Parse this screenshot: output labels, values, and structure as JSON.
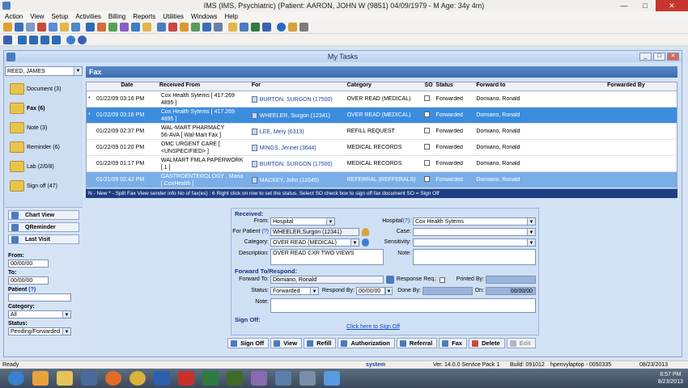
{
  "window": {
    "title": "IMS (IMS, Psychiatric)    (Patient: AARON, JOHN W (9851) 04/09/1979 - M Age: 34y 4m)"
  },
  "menu": [
    "Action",
    "View",
    "Setup",
    "Activities",
    "Billing",
    "Reports",
    "Utilities",
    "Windows",
    "Help"
  ],
  "mdi": {
    "title": "My Tasks"
  },
  "user": {
    "selected": "REED, JAMES"
  },
  "nav": [
    {
      "label": "Document (3)"
    },
    {
      "label": "Fax (6)"
    },
    {
      "label": "Note (3)"
    },
    {
      "label": "Reminder (6)"
    },
    {
      "label": "Lab (2/0/8)"
    },
    {
      "label": "Sign off (47)"
    }
  ],
  "left_buttons": {
    "chart_view": "Chart View",
    "qreminder": "QReminder",
    "last_visit": "Last Visit"
  },
  "filters": {
    "from_label": "From:",
    "from_value": "00/00/00",
    "to_label": "To:",
    "to_value": "00/00/00",
    "patient_label": "Patient",
    "patient_help": "(?)",
    "category_label": "Category:",
    "category_value": "All",
    "status_label": "Status:",
    "status_value": "Pending/Forwarded"
  },
  "fax_header": "Fax",
  "grid": {
    "columns": [
      "Date",
      "Received From",
      "For",
      "Category",
      "SO",
      "Status",
      "Forward to",
      "Forwarded By"
    ],
    "rows": [
      {
        "mark": "*",
        "date": "01/22/09",
        "time": "03:16 PM",
        "from1": "Cox Health Sytems [ 417.269",
        "from2": "4895 ]",
        "for": "BURTON, SURGON  (17500)",
        "category": "OVER READ (MEDICAL)",
        "status": "Forwarded",
        "forward_to": "Domiano, Ronald",
        "forwarded_by": ""
      },
      {
        "mark": "*",
        "date": "01/22/09",
        "time": "03:16 PM",
        "from1": "Cox Health Sytems [ 417.269",
        "from2": "4895 ]",
        "for": "WHEELER, Surgon  (12341)",
        "category": "OVER READ (MEDICAL)",
        "status": "Forwarded",
        "forward_to": "Domiano, Ronald",
        "forwarded_by": ""
      },
      {
        "mark": "",
        "date": "01/22/09",
        "time": "02:37 PM",
        "from1": "WAL-MART PHARMACY",
        "from2": "56-AVA [ Wal-Mart Fax ]",
        "for": "LEE, Mery  (6313)",
        "category": "REFILL REQUEST",
        "status": "Forwarded",
        "forward_to": "Domiano, Ronald",
        "forwarded_by": ""
      },
      {
        "mark": "",
        "date": "01/22/09",
        "time": "01:20 PM",
        "from1": "OMC URGENT CARE [",
        "from2": "<UNSPECIFIED> ]",
        "for": "MINGS, Jennet  (3644)",
        "category": "MEDICAL RECORDS",
        "status": "Forwarded",
        "forward_to": "Domiano, Ronald",
        "forwarded_by": ""
      },
      {
        "mark": "",
        "date": "01/22/09",
        "time": "01:17 PM",
        "from1": "WALMART FMLA PAPERWORK",
        "from2": "[ 1 ]",
        "for": "BURTON, SURGON  (17500)",
        "category": "MEDICAL RECORDS",
        "status": "Forwarded",
        "forward_to": "Domiano, Ronald",
        "forwarded_by": ""
      },
      {
        "mark": "",
        "date": "01/21/09",
        "time": "02:42 PM",
        "from1": "GASTROENTEROLOGY , Maria",
        "from2": "[ CoxHealth ]",
        "for": "MACKEY, John  (11645)",
        "category": "REFERRAL  (REFFERALS)",
        "status": "Forwarded",
        "forward_to": "Domiano, Ronald",
        "forwarded_by": ""
      }
    ],
    "footer": "N - New  * - Split Fax   View sender info        No of fax(es) : 6    Right click on row to set the status.                 Select SO check box to sign off fax document     SO = Sign Off"
  },
  "detail": {
    "received_title": "Received:",
    "from_label": "From:",
    "from_value": "Hospital",
    "hospital_label": "Hospital",
    "hospital_help": "(?)",
    "hospital_value": "Cox Health Sytems",
    "for_patient_label": "For Patient",
    "for_patient_help": "(?)",
    "for_patient_value": "WHEELER,Surgon (12341)",
    "case_label": "Case:",
    "category_label": "Category:",
    "category_value": "OVER READ (MEDICAL)",
    "sensitivity_label": "Sensitivity:",
    "description_label": "Description:",
    "description_value": "OVER READ CXR TWO VIEWS",
    "note_label": "Note:",
    "fwd_title": "Forward To/Respond:",
    "forward_to_label": "Forward To:",
    "forward_to_value": "Domiano, Ronald",
    "response_req_label": "Response Req.:",
    "printed_by_label": "Printed By:",
    "status_label": "Status:",
    "status_value": "Forwarded",
    "respond_by_label": "Respond By:",
    "respond_by_value": "00/00/00",
    "done_by_label": "Done By:",
    "on_label": "On:",
    "on_value": "00/00/00",
    "note2_label": "Note:",
    "signoff_title": "Sign Off:",
    "signoff_link": "Click here to Sign Off"
  },
  "actions": [
    "Sign Off",
    "View",
    "Refill",
    "Authorization",
    "Referral",
    "Fax",
    "Delete",
    "Edit"
  ],
  "statusbar": {
    "left": "Ready",
    "user": "system",
    "version": "Ver. 14.0.0 Service Pack 1",
    "build": "Build: 091012",
    "machine": "hpenvylaptop - 0050335",
    "date": "08/23/2013"
  },
  "clock": {
    "time": "8:57 PM",
    "date": "8/23/2013"
  }
}
